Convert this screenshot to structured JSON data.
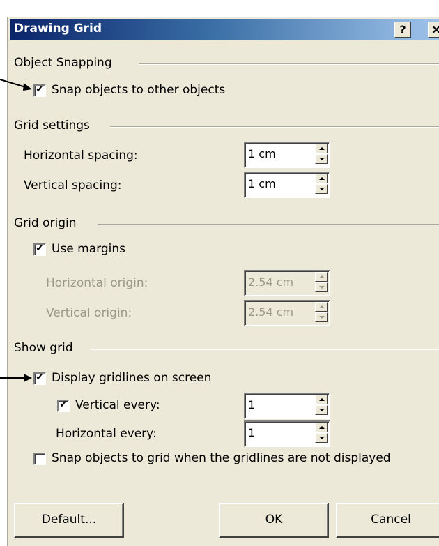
{
  "dialog": {
    "title": "Drawing Grid",
    "help_button": "?",
    "close_button": "×"
  },
  "object_snapping": {
    "heading": "Object Snapping",
    "snap_to_objects": {
      "label": "Snap objects to other objects",
      "checked": true
    }
  },
  "grid_settings": {
    "heading": "Grid settings",
    "horizontal_spacing": {
      "label": "Horizontal spacing:",
      "value": "1 cm"
    },
    "vertical_spacing": {
      "label": "Vertical spacing:",
      "value": "1 cm"
    }
  },
  "grid_origin": {
    "heading": "Grid origin",
    "use_margins": {
      "label": "Use margins",
      "checked": true
    },
    "horizontal_origin": {
      "label": "Horizontal origin:",
      "value": "2.54 cm",
      "enabled": false
    },
    "vertical_origin": {
      "label": "Vertical origin:",
      "value": "2.54 cm",
      "enabled": false
    }
  },
  "show_grid": {
    "heading": "Show grid",
    "display_gridlines": {
      "label": "Display gridlines on screen",
      "checked": true
    },
    "vertical_every": {
      "label": "Vertical every:",
      "value": "1",
      "checked": true
    },
    "horizontal_every": {
      "label": "Horizontal every:",
      "value": "1"
    },
    "snap_when_hidden": {
      "label": "Snap objects to grid when the gridlines are not displayed",
      "checked": false
    }
  },
  "buttons": {
    "default": "Default...",
    "ok": "OK",
    "cancel": "Cancel"
  },
  "checkmark": "✔"
}
